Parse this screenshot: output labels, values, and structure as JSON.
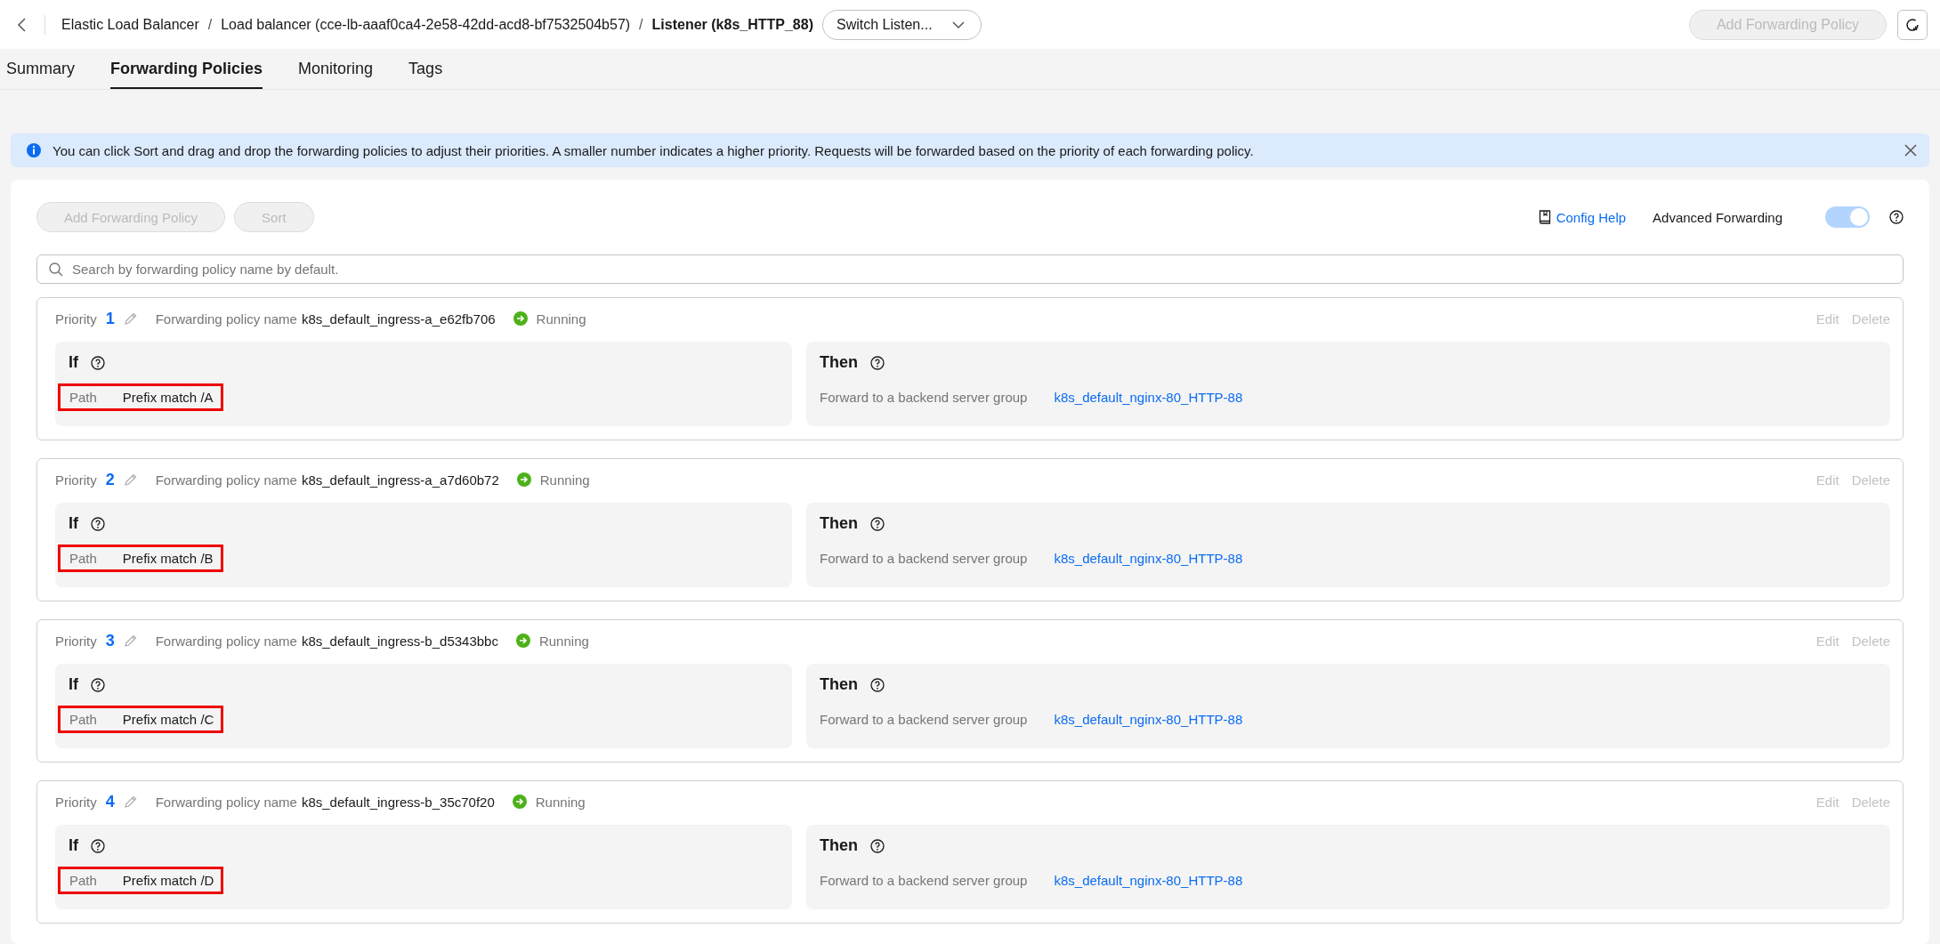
{
  "breadcrumb": [
    {
      "label": "Elastic Load Balancer",
      "current": false
    },
    {
      "label": "Load balancer (cce-lb-aaaf0ca4-2e58-42dd-acd8-bf7532504b57)",
      "current": false
    },
    {
      "label": "Listener (k8s_HTTP_88)",
      "current": true
    }
  ],
  "breadcrumb_separator": "/",
  "switch_listener": {
    "label": "Switch Listen..."
  },
  "header_button": {
    "label": "Add Forwarding Policy",
    "disabled": true
  },
  "tabs": [
    {
      "label": "Summary",
      "selected": false
    },
    {
      "label": "Forwarding Policies",
      "selected": true
    },
    {
      "label": "Monitoring",
      "selected": false
    },
    {
      "label": "Tags",
      "selected": false
    }
  ],
  "notice": {
    "text": "You can click Sort and drag and drop the forwarding policies to adjust their priorities. A smaller number indicates a higher priority. Requests will be forwarded based on the priority of each forwarding policy."
  },
  "toolbar": {
    "buttons": [
      {
        "label": "Add Forwarding Policy",
        "disabled": true
      },
      {
        "label": "Sort",
        "disabled": true
      }
    ],
    "config_help": "Config Help",
    "advanced_forwarding": {
      "label": "Advanced Forwarding",
      "on": true,
      "disabled": true
    }
  },
  "search": {
    "placeholder": "Search by forwarding policy name by default."
  },
  "policies": [
    {
      "priority_label": "Priority",
      "priority": "1",
      "name_label": "Forwarding policy name",
      "name": "k8s_default_ingress-a_e62fb706",
      "status": "Running",
      "actions": [
        "Edit",
        "Delete"
      ],
      "if_title": "If",
      "condition": {
        "field": "Path",
        "value": "Prefix match /A",
        "highlighted": true
      },
      "then_title": "Then",
      "action_label": "Forward to a backend server group",
      "target": "k8s_default_nginx-80_HTTP-88"
    },
    {
      "priority_label": "Priority",
      "priority": "2",
      "name_label": "Forwarding policy name",
      "name": "k8s_default_ingress-a_a7d60b72",
      "status": "Running",
      "actions": [
        "Edit",
        "Delete"
      ],
      "if_title": "If",
      "condition": {
        "field": "Path",
        "value": "Prefix match /B",
        "highlighted": true
      },
      "then_title": "Then",
      "action_label": "Forward to a backend server group",
      "target": "k8s_default_nginx-80_HTTP-88"
    },
    {
      "priority_label": "Priority",
      "priority": "3",
      "name_label": "Forwarding policy name",
      "name": "k8s_default_ingress-b_d5343bbc",
      "status": "Running",
      "actions": [
        "Edit",
        "Delete"
      ],
      "if_title": "If",
      "condition": {
        "field": "Path",
        "value": "Prefix match /C",
        "highlighted": true
      },
      "then_title": "Then",
      "action_label": "Forward to a backend server group",
      "target": "k8s_default_nginx-80_HTTP-88"
    },
    {
      "priority_label": "Priority",
      "priority": "4",
      "name_label": "Forwarding policy name",
      "name": "k8s_default_ingress-b_35c70f20",
      "status": "Running",
      "actions": [
        "Edit",
        "Delete"
      ],
      "if_title": "If",
      "condition": {
        "field": "Path",
        "value": "Prefix match /D",
        "highlighted": true
      },
      "then_title": "Then",
      "action_label": "Forward to a backend server group",
      "target": "k8s_default_nginx-80_HTTP-88"
    }
  ]
}
